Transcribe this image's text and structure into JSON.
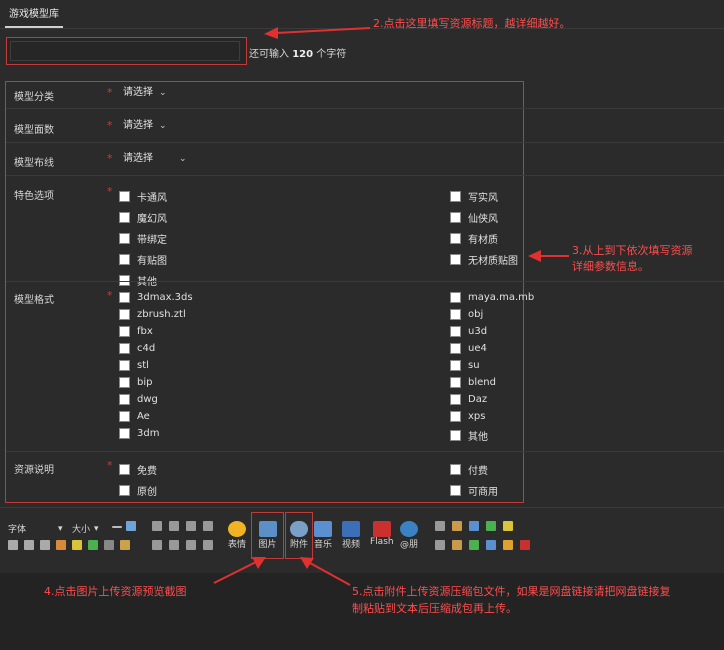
{
  "tab": {
    "label": "游戏模型库"
  },
  "title_field": {
    "remaining_prefix": "还可输入",
    "remaining_count": "120",
    "remaining_suffix": "个字符"
  },
  "annotations": {
    "a2": "2.点击这里填写资源标题，越详细越好。",
    "a3_l1": "3.从上到下依次填写资源",
    "a3_l2": "详细参数信息。",
    "a4": "4.点击图片上传资源预览截图",
    "a5_l1": "5.点击附件上传资源压缩包文件，如果是网盘链接请把网盘链接复",
    "a5_l2": "制粘贴到文本后压缩成包再上传。"
  },
  "form": {
    "category": {
      "label": "模型分类",
      "value": "请选择"
    },
    "faces": {
      "label": "模型面数",
      "value": "请选择"
    },
    "wiring": {
      "label": "模型布线",
      "value": "请选择"
    },
    "features": {
      "label": "特色选项",
      "left": [
        "卡通风",
        "魔幻风",
        "带绑定",
        "有贴图",
        "其他"
      ],
      "right": [
        "写实风",
        "仙侠风",
        "有材质",
        "无材质贴图"
      ]
    },
    "format": {
      "label": "模型格式",
      "left": [
        "3dmax.3ds",
        "zbrush.ztl",
        "fbx",
        "c4d",
        "stl",
        "bip",
        "dwg",
        "Ae",
        "3dm"
      ],
      "right": [
        "maya.ma.mb",
        "obj",
        "u3d",
        "ue4",
        "su",
        "blend",
        "Daz",
        "xps",
        "其他"
      ]
    },
    "license": {
      "label": "资源说明",
      "left": [
        "免费",
        "原创"
      ],
      "right": [
        "付费",
        "可商用"
      ]
    }
  },
  "toolbar": {
    "font": "字体",
    "size": "大小",
    "emoji": "表情",
    "image": "图片",
    "attach": "附件",
    "music": "音乐",
    "video": "视频",
    "flash": "Flash",
    "at": "@朋"
  }
}
